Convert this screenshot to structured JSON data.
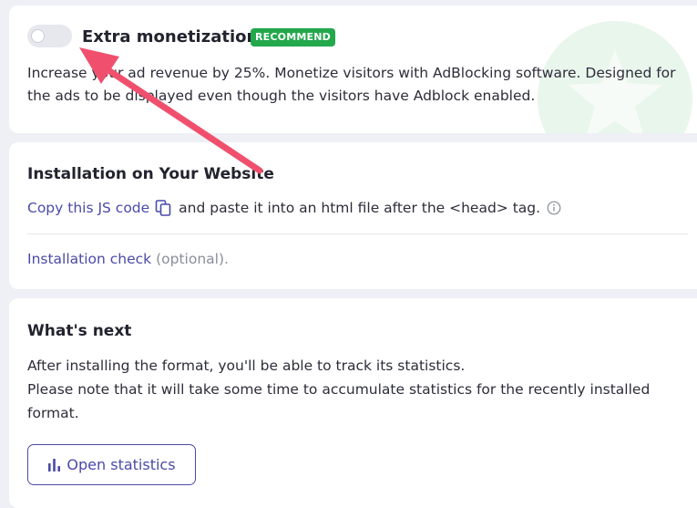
{
  "extra_monetization": {
    "title": "Extra monetization",
    "badge": "RECOMMEND",
    "toggle_state": "off",
    "description": "Increase your ad revenue by 25%. Monetize visitors with AdBlocking software. Designed for the ads to be displayed even though the visitors have Adblock enabled."
  },
  "installation": {
    "title": "Installation on Your Website",
    "copy_link": "Copy this JS code",
    "after_copy": "and paste it into an html file after the <head> tag.",
    "check_link": "Installation check",
    "check_optional": "(optional)."
  },
  "whats_next": {
    "title": "What's next",
    "line1": "After installing the format, you'll be able to track its statistics.",
    "line2": "Please note that it will take some time to accumulate statistics for the recently installed format.",
    "button_label": "Open statistics"
  },
  "colors": {
    "accent": "#4a4aa8",
    "badge_green": "#23a84c",
    "annotation_arrow": "#f0506e",
    "background": "#eef0f5"
  },
  "icons": {
    "copy": "copy-icon",
    "info": "info-icon",
    "statistics": "bar-chart-icon",
    "decoration": "star-icon"
  }
}
